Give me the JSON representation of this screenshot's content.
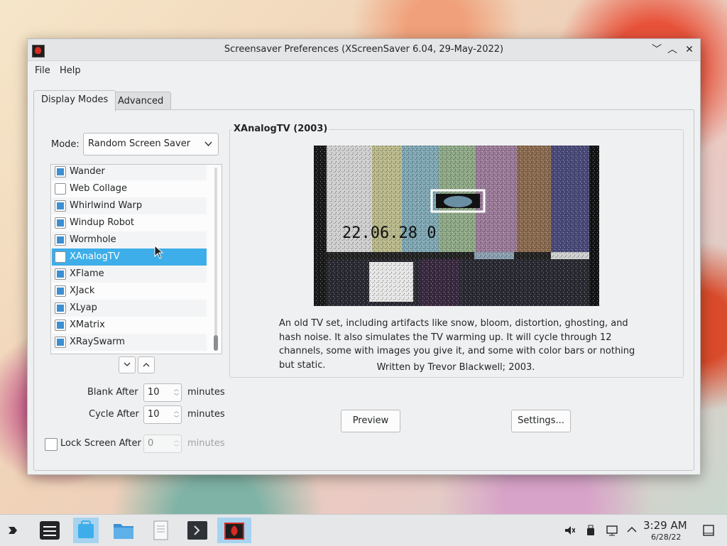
{
  "window": {
    "title": "Screensaver Preferences (XScreenSaver 6.04, 29-May-2022)",
    "controls": {
      "minimize": "﹀",
      "maximize": "︿",
      "close": "✕"
    }
  },
  "menubar": {
    "file": "File",
    "help": "Help"
  },
  "tabs": [
    "Display Modes",
    "Advanced"
  ],
  "mode": {
    "label": "Mode:",
    "value": "Random Screen Saver"
  },
  "list": [
    {
      "name": "Wander",
      "checked": true
    },
    {
      "name": "Web Collage",
      "checked": false
    },
    {
      "name": "Whirlwind Warp",
      "checked": true
    },
    {
      "name": "Windup Robot",
      "checked": true
    },
    {
      "name": "Wormhole",
      "checked": true
    },
    {
      "name": "XAnalogTV",
      "checked": false,
      "selected": true
    },
    {
      "name": "XFlame",
      "checked": true
    },
    {
      "name": "XJack",
      "checked": true
    },
    {
      "name": "XLyap",
      "checked": true
    },
    {
      "name": "XMatrix",
      "checked": true
    },
    {
      "name": "XRaySwarm",
      "checked": true
    }
  ],
  "timing": {
    "blank_after": {
      "label": "Blank After",
      "value": "10",
      "unit": "minutes"
    },
    "cycle_after": {
      "label": "Cycle After",
      "value": "10",
      "unit": "minutes"
    },
    "lock_after": {
      "label": "Lock Screen After",
      "value": "0",
      "unit": "minutes",
      "checked": false
    }
  },
  "saver": {
    "title": "XAnalogTV (2003)",
    "description": "An old TV set, including artifacts like snow, bloom, distortion, ghosting, and hash noise. It also simulates the TV warming up. It will cycle through 12 channels, some with images you give it, and some with color bars or nothing but static.",
    "credit": "Written by Trevor Blackwell; 2003.",
    "overlay_text": "22.06.28 0"
  },
  "buttons": {
    "preview": "Preview",
    "settings": "Settings..."
  },
  "taskbar": {
    "time": "3:29 AM",
    "date": "6/28/22"
  },
  "colors": {
    "accent": "#3daee9",
    "checkbox": "#3d8fd1"
  }
}
